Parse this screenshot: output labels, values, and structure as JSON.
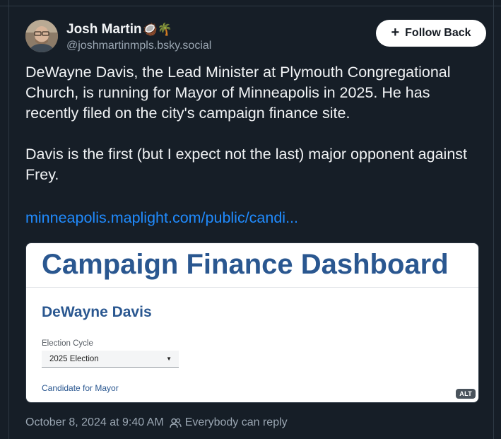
{
  "post": {
    "author_name": "Josh Martin",
    "author_emoji": "🥥🌴",
    "handle": "@joshmartinmpls.bsky.social",
    "follow_label": "Follow Back",
    "paragraphs": [
      "DeWayne Davis, the Lead Minister at Plymouth Congregational Church, is running for Mayor of Minneapolis in 2025. He has recently filed on the city's campaign finance site.",
      "Davis is the first (but I expect not the last) major opponent against Frey."
    ],
    "link_text": "minneapolis.maplight.com/public/candi...",
    "timestamp": "October 8, 2024 at 9:40 AM",
    "reply_setting": "Everybody can reply"
  },
  "embed": {
    "dashboard_title": "Campaign Finance Dashboard",
    "candidate_name": "DeWayne Davis",
    "cycle_label": "Election Cycle",
    "cycle_value": "2025 Election",
    "candidate_for": "Candidate for Mayor",
    "alt_badge": "ALT"
  },
  "icons": {
    "follow": "plus-icon",
    "reply_setting": "people-icon",
    "select": "caret-down-icon"
  },
  "colors": {
    "background": "#161e27",
    "link": "#208bfe",
    "muted_text": "#9aa6b2",
    "dashboard_blue": "#2a5790"
  }
}
